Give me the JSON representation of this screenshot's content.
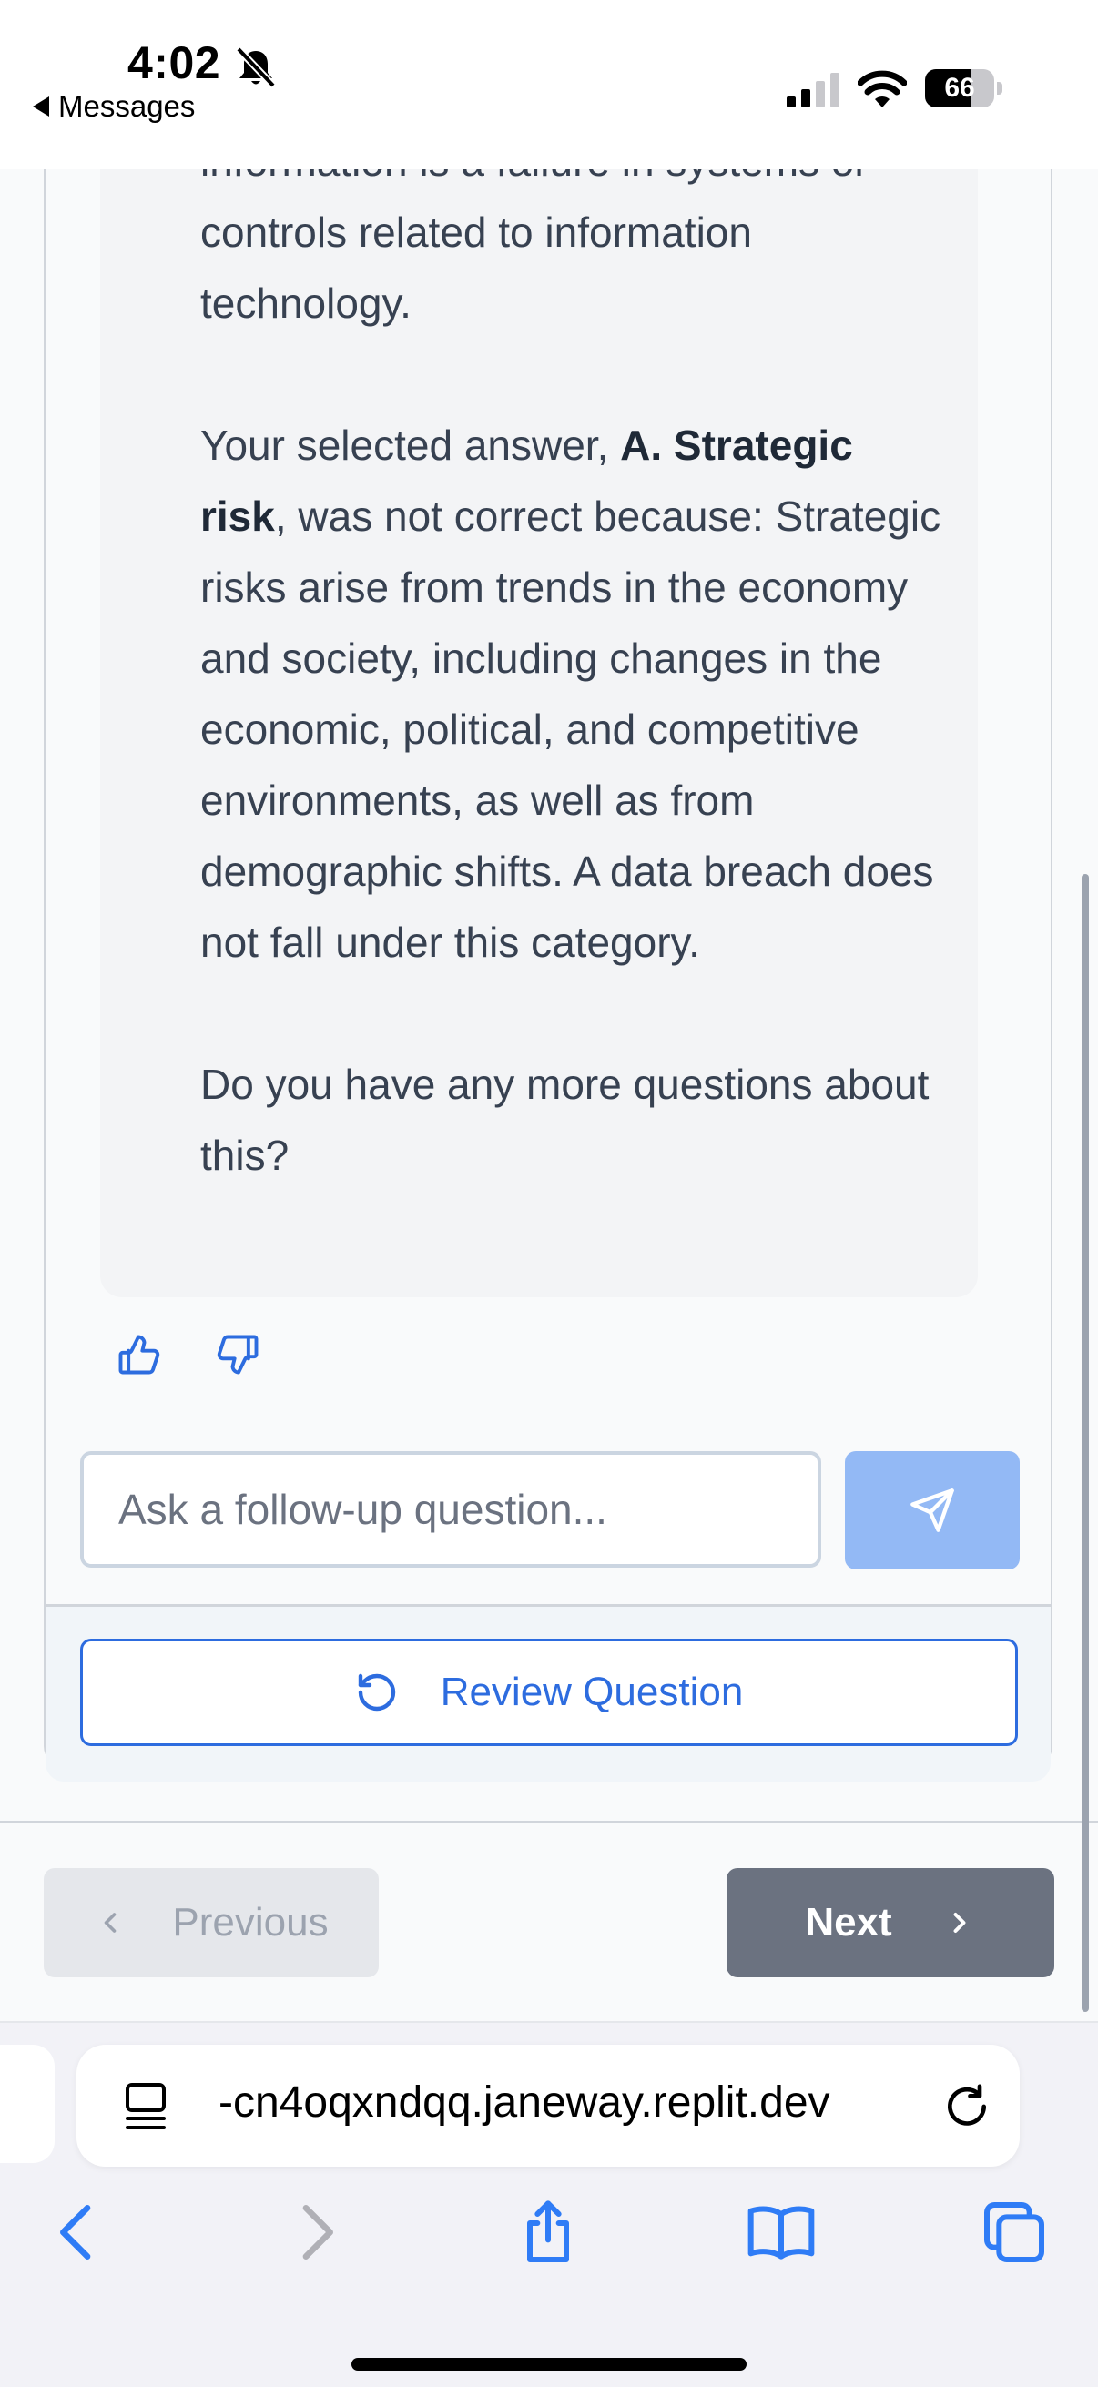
{
  "status_bar": {
    "time": "4:02",
    "back_app_label": "Messages",
    "battery_percent": "66",
    "battery_level": 0.66
  },
  "explanation": {
    "para1": "information is a failure in systems or controls related to information technology.",
    "para2_prefix": "Your selected answer, ",
    "para2_bold": "A. Strategic risk",
    "para2_rest": ", was not correct because: Strategic risks arise from trends in the economy and society, including changes in the economic, political, and competitive environments, as well as from demographic shifts. A data breach does not fall under this category.",
    "para3": "Do you have any more questions about this?"
  },
  "feedback": {
    "thumbs_up_icon": "thumbs-up-icon",
    "thumbs_down_icon": "thumbs-down-icon"
  },
  "followup": {
    "placeholder": "Ask a follow-up question...",
    "value": "",
    "send_icon": "send-icon"
  },
  "review_button": {
    "label": "Review Question",
    "icon": "rotate-ccw-icon"
  },
  "navigation": {
    "previous_label": "Previous",
    "next_label": "Next"
  },
  "browser": {
    "url": "-cn4oqxndqq.janeway.replit.dev",
    "toolbar_icons": [
      "back-icon",
      "forward-icon",
      "share-icon",
      "bookmarks-icon",
      "tabs-icon"
    ]
  },
  "colors": {
    "accent": "#2d6cdf",
    "send_button": "#93b9f5",
    "next_button": "#6b7280",
    "previous_button": "#e5e7eb"
  }
}
